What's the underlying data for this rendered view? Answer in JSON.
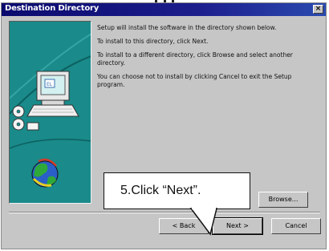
{
  "window": {
    "title": "Destination Directory",
    "close_glyph": "×"
  },
  "content": {
    "paragraphs": [
      "Setup will install the software in the directory shown below.",
      "To install to this directory, click Next.",
      "To install to a different directory, click Browse and select another directory.",
      "You can choose not to install by clicking Cancel to exit the Setup program."
    ]
  },
  "buttons": {
    "browse_label": "Browse...",
    "back_label": "< Back",
    "next_label": "Next >",
    "cancel_label": "Cancel"
  },
  "annotation": {
    "callout_text": "5.Click “Next”."
  },
  "icons": {
    "art_panel": [
      "computer-icon",
      "disks-icon",
      "globe-icon"
    ]
  }
}
